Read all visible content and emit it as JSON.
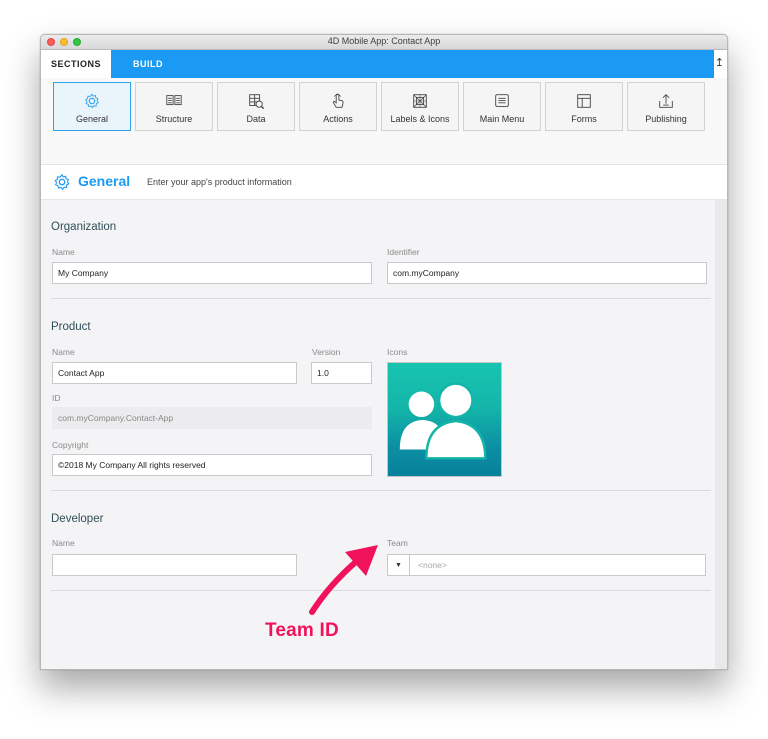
{
  "window": {
    "title": "4D Mobile App: Contact App"
  },
  "tabs": {
    "sections": "SECTIONS",
    "build": "BUILD"
  },
  "toolbar": [
    {
      "label": "General",
      "icon": "gear-icon",
      "active": true
    },
    {
      "label": "Structure",
      "icon": "structure-icon",
      "active": false
    },
    {
      "label": "Data",
      "icon": "data-icon",
      "active": false
    },
    {
      "label": "Actions",
      "icon": "actions-icon",
      "active": false
    },
    {
      "label": "Labels & Icons",
      "icon": "labels-icons-icon",
      "active": false
    },
    {
      "label": "Main Menu",
      "icon": "main-menu-icon",
      "active": false
    },
    {
      "label": "Forms",
      "icon": "forms-icon",
      "active": false
    },
    {
      "label": "Publishing",
      "icon": "publishing-icon",
      "active": false
    }
  ],
  "section": {
    "title": "General",
    "description": "Enter your app's product information"
  },
  "organization": {
    "title": "Organization",
    "name_label": "Name",
    "name_value": "My Company",
    "identifier_label": "Identifier",
    "identifier_value": "com.myCompany"
  },
  "product": {
    "title": "Product",
    "name_label": "Name",
    "name_value": "Contact App",
    "version_label": "Version",
    "version_value": "1.0",
    "icons_label": "Icons",
    "id_label": "ID",
    "id_value": "com.myCompany.Contact-App",
    "copyright_label": "Copyright",
    "copyright_value": "©2018 My Company All rights reserved"
  },
  "developer": {
    "title": "Developer",
    "name_label": "Name",
    "name_value": "",
    "team_label": "Team",
    "team_value": "<none>"
  },
  "annotation": {
    "text": "Team ID",
    "color": "#f0135c"
  },
  "colors": {
    "accent": "#1a9af2",
    "icon_tile": "#14b5a9"
  }
}
